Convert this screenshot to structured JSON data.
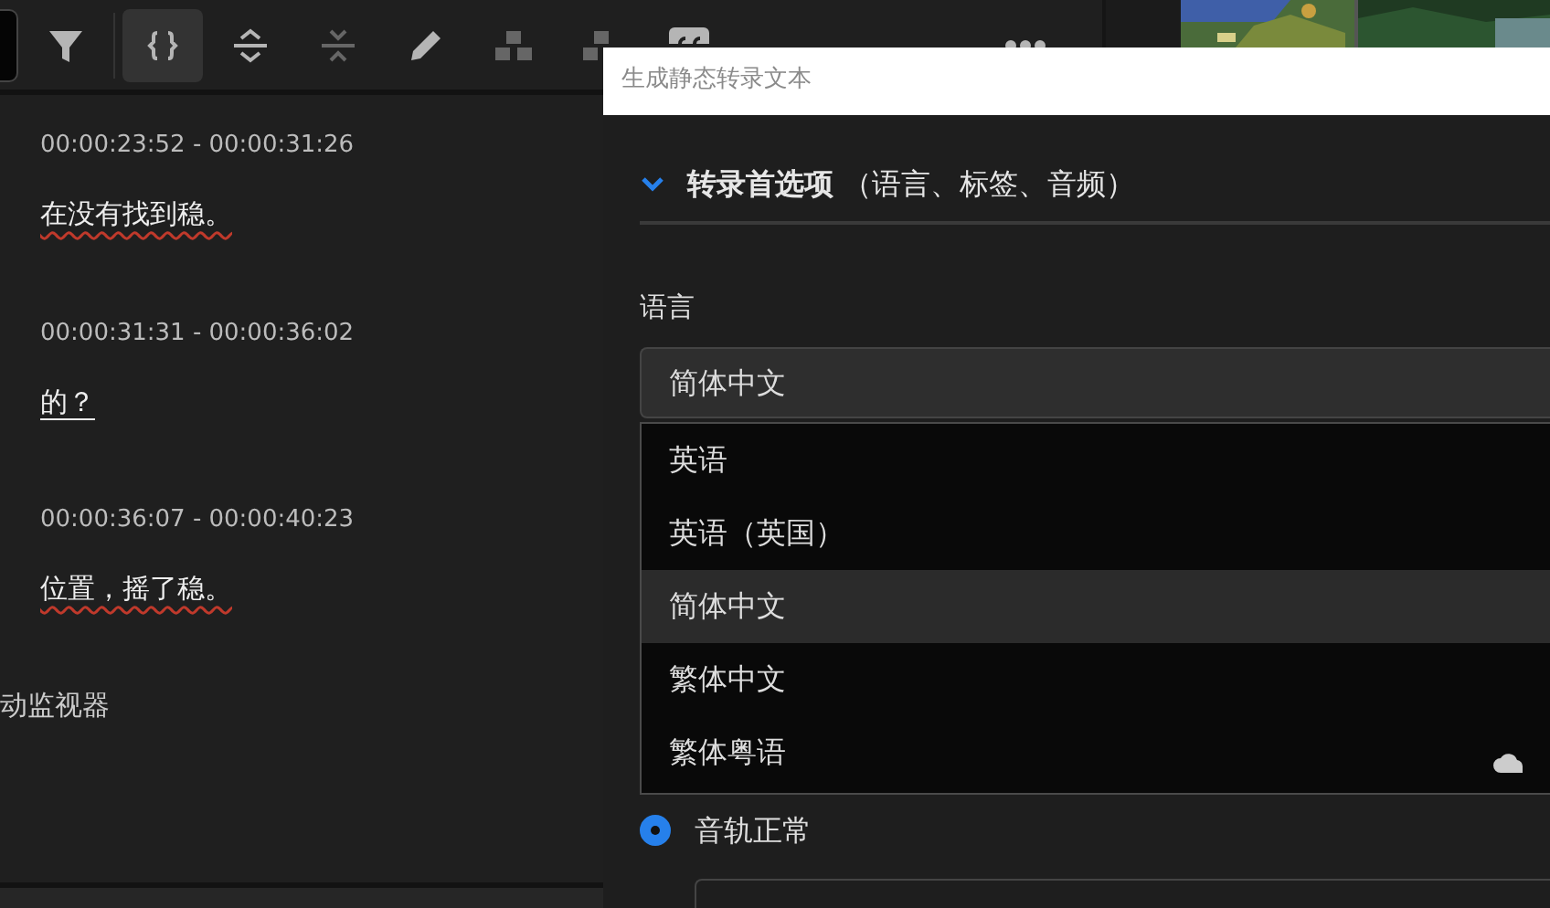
{
  "toolbar": [
    {
      "kind": "filter",
      "selected": false,
      "disabled": false
    },
    {
      "kind": "braces",
      "selected": true,
      "disabled": false
    },
    {
      "kind": "expand",
      "selected": false,
      "disabled": false
    },
    {
      "kind": "collapse",
      "selected": false,
      "disabled": true
    },
    {
      "kind": "pencil",
      "selected": false,
      "disabled": false
    },
    {
      "kind": "merge",
      "selected": false,
      "disabled": true
    },
    {
      "kind": "split",
      "selected": false,
      "disabled": true
    },
    {
      "kind": "cc",
      "selected": false,
      "disabled": false
    },
    {
      "kind": "more",
      "selected": false,
      "disabled": false
    }
  ],
  "transcript": [
    {
      "time": "00:00:23:52 - 00:00:31:26",
      "text": "在没有找到稳。",
      "spell_error": true
    },
    {
      "time": "00:00:31:31 - 00:00:36:02",
      "text": "的？",
      "spell_error": false
    },
    {
      "time": "00:00:36:07 - 00:00:40:23",
      "text": "位置，摇了稳。",
      "spell_error": true
    }
  ],
  "panel_label": "动监视器",
  "dialog": {
    "title": "生成静态转录文本",
    "section": {
      "title": "**转录首选项** （语言、标签、音频）",
      "expanded": true
    },
    "language_label": "语言",
    "language_value": "简体中文",
    "options": [
      {
        "label": "英语",
        "selected": false
      },
      {
        "label": "英语（英国）",
        "selected": false
      },
      {
        "label": "简体中文",
        "selected": true
      },
      {
        "label": "繁体中文",
        "selected": false
      },
      {
        "label": "繁体粤语",
        "selected": false
      }
    ],
    "radio": {
      "label": "音轨正常",
      "checked": true
    }
  }
}
